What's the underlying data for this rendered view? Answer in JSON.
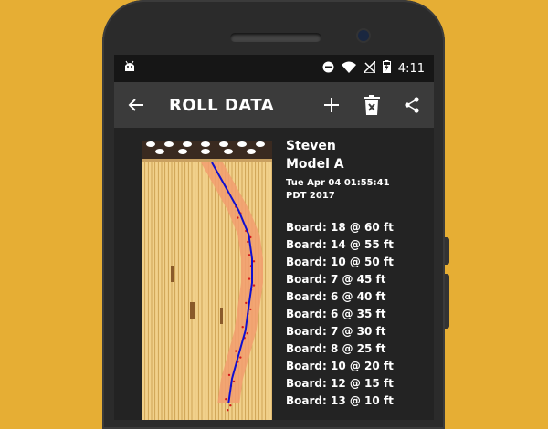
{
  "status": {
    "time": "4:11",
    "battery_level": 0.7
  },
  "toolbar": {
    "title": "ROLL DATA"
  },
  "roll": {
    "bowler": "Steven",
    "ball": "Model A",
    "date_line1": "Tue Apr 04 01:55:41",
    "date_line2": "PDT 2017",
    "boards": [
      "Board: 18 @ 60 ft",
      "Board: 14 @ 55 ft",
      "Board: 10 @ 50 ft",
      "Board: 7 @ 45 ft",
      "Board: 6 @ 40 ft",
      "Board: 6 @ 35 ft",
      "Board: 7 @ 30 ft",
      "Board: 8 @ 25 ft",
      "Board: 10 @ 20 ft",
      "Board: 12 @ 15 ft",
      "Board: 13 @ 10 ft"
    ]
  },
  "colors": {
    "background": "#E6AE34",
    "lane_wood": "#F1D08A",
    "oil_band": "#F29E6E",
    "ball_path": "#1010D0",
    "dots": "#D41A1A"
  },
  "icons": {
    "back": "arrow-left-icon",
    "add": "plus-icon",
    "delete": "trash-icon",
    "share": "share-icon",
    "app": "android-icon"
  }
}
